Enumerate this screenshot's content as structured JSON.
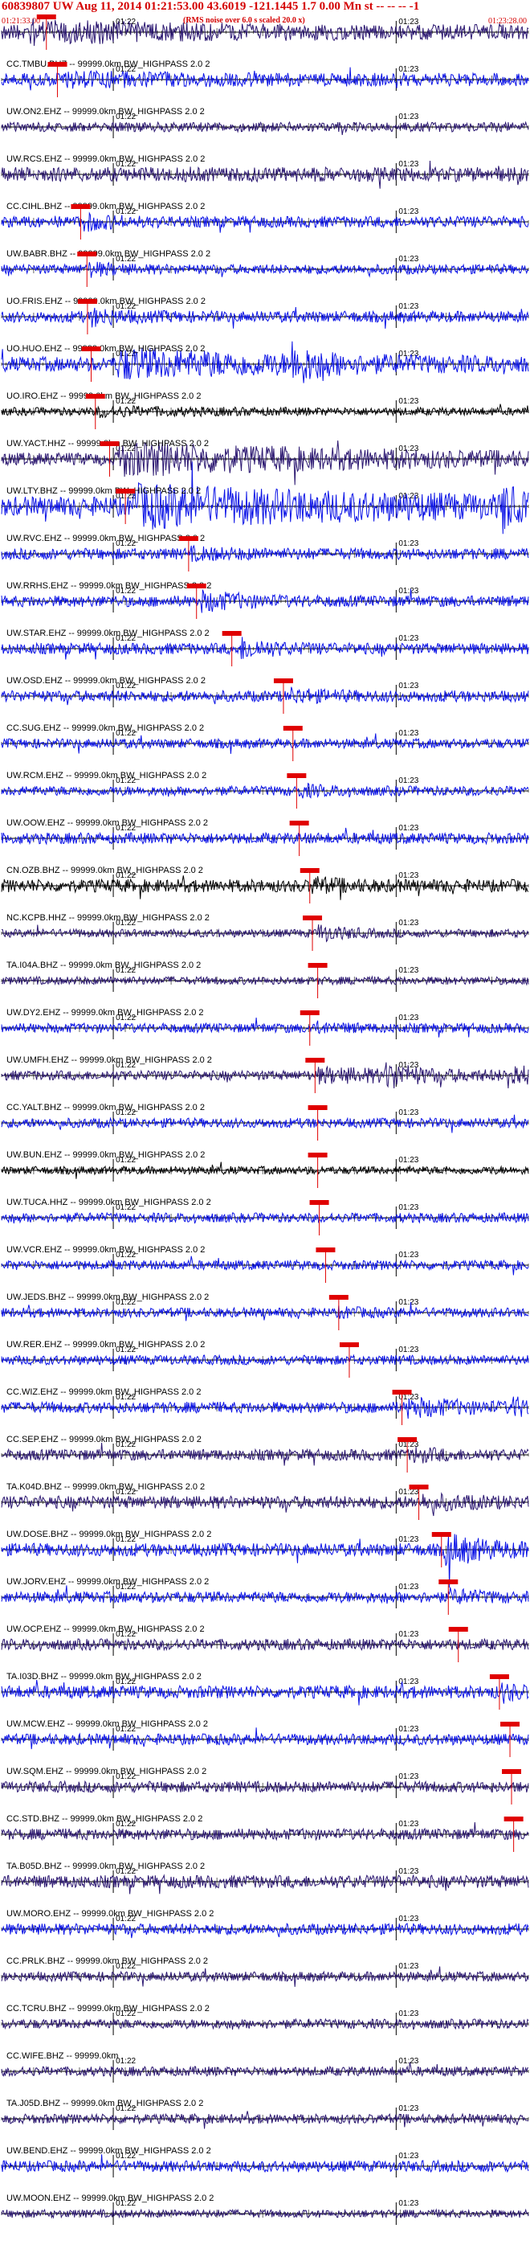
{
  "header": {
    "title": "60839807 UW Aug 11, 2014 01:21:53.00   43.6019 -121.1445  1.7 0.00 Mn st -- -- --  -1",
    "note": "(RMS noise over 6.0 s scaled 20.0 x)",
    "start_time": "01:21:33.00",
    "end_time": "01:23:28.00"
  },
  "colors": {
    "pick": "#e00000",
    "trace_blue": "#0a12e6",
    "trace_navy": "#2a1670",
    "trace_black": "#000000",
    "axis": "#000000"
  },
  "chart_data": {
    "type": "line",
    "x_ticks": [
      {
        "label": "01:22",
        "t": 0.212
      },
      {
        "label": "01:23",
        "t": 0.749
      }
    ],
    "traces": [
      {
        "label": "",
        "color": "navy",
        "amp": 9,
        "pick": 0.085,
        "bursts": [
          [
            0.05,
            0.3,
            2.0
          ]
        ]
      },
      {
        "label": "CC.TMBU.BHZ -- 99999.0km BW_HIGHPASS  2.0  2",
        "color": "blue",
        "amp": 8,
        "pick": 0.106,
        "bursts": [
          [
            0.12,
            0.25,
            1.5
          ]
        ]
      },
      {
        "label": "UW.ON2.EHZ -- 99999.0km BW_HIGHPASS  2.0  2",
        "color": "navy",
        "amp": 6,
        "pick": null,
        "bursts": []
      },
      {
        "label": "UW.RCS.EHZ -- 99999.0km BW_HIGHPASS  2.0  2",
        "color": "navy",
        "amp": 9,
        "pick": null,
        "bursts": []
      },
      {
        "label": "CC.CIHL.BHZ -- 99999.0km BW_HIGHPASS  2.0  2",
        "color": "blue",
        "amp": 7,
        "pick": 0.15,
        "bursts": [
          [
            0.155,
            0.05,
            2.0
          ]
        ]
      },
      {
        "label": "UW.BABR.BHZ -- 99999.0km BW_HIGHPASS  2.0  2",
        "color": "blue",
        "amp": 6,
        "pick": 0.162,
        "bursts": [
          [
            0.165,
            0.05,
            2.0
          ]
        ]
      },
      {
        "label": "UO.FRIS.EHZ -- 99999.0km BW_HIGHPASS  2.0  2",
        "color": "blue",
        "amp": 7,
        "pick": 0.163,
        "bursts": [
          [
            0.17,
            0.06,
            2.0
          ]
        ]
      },
      {
        "label": "UO.HUO.EHZ -- 99999.0km BW_HIGHPASS  2.0  2",
        "color": "blue",
        "amp": 9,
        "pick": 0.17,
        "bursts": [
          [
            0.22,
            0.35,
            2.5
          ],
          [
            0.55,
            0.04,
            3.2
          ]
        ]
      },
      {
        "label": "UO.IRO.EHZ -- 99999.0km BW_HIGHPASS  2.0  2",
        "color": "black",
        "amp": 5,
        "pick": 0.178,
        "bursts": [
          [
            0.18,
            0.15,
            1.8
          ]
        ]
      },
      {
        "label": "UW.YACT.HHZ -- 99999.0km BW_HIGHPASS  2.0  2",
        "color": "navy",
        "amp": 8,
        "pick": 0.205,
        "bursts": [
          [
            0.22,
            0.45,
            3.0
          ]
        ]
      },
      {
        "label": "UW.LTY.BHZ -- 99999.0km BW_HIGHPASS  2.0  2",
        "color": "blue",
        "amp": 12,
        "pick": 0.235,
        "bursts": [
          [
            0.25,
            0.5,
            2.5
          ],
          [
            0.95,
            0.02,
            3.0
          ]
        ]
      },
      {
        "label": "UW.RVC.EHZ -- 99999.0km BW_HIGHPASS  2.0  2",
        "color": "blue",
        "amp": 7,
        "pick": 0.355,
        "bursts": [
          [
            0.36,
            0.1,
            1.5
          ]
        ]
      },
      {
        "label": "UW.RRHS.EHZ -- 99999.0km BW_HIGHPASS  2.0  2",
        "color": "blue",
        "amp": 7,
        "pick": 0.37,
        "bursts": [
          [
            0.38,
            0.08,
            2.2
          ]
        ]
      },
      {
        "label": "UW.STAR.EHZ -- 99999.0km BW_HIGHPASS  2.0  2",
        "color": "blue",
        "amp": 7,
        "pick": 0.437,
        "bursts": [
          [
            0.455,
            0.05,
            2.5
          ]
        ]
      },
      {
        "label": "UW.OSD.EHZ -- 99999.0km BW_HIGHPASS  2.0  2",
        "color": "blue",
        "amp": 7,
        "pick": 0.535,
        "bursts": [
          [
            0.55,
            0.06,
            1.8
          ]
        ]
      },
      {
        "label": "CC.SUG.EHZ -- 99999.0km BW_HIGHPASS  2.0  2",
        "color": "blue",
        "amp": 6,
        "pick": 0.553,
        "bursts": []
      },
      {
        "label": "UW.RCM.EHZ -- 99999.0km BW_HIGHPASS  2.0  2",
        "color": "blue",
        "amp": 6,
        "pick": 0.56,
        "bursts": [
          [
            0.565,
            0.05,
            1.8
          ]
        ]
      },
      {
        "label": "UW.OOW.EHZ -- 99999.0km BW_HIGHPASS  2.0  2",
        "color": "blue",
        "amp": 7,
        "pick": 0.565,
        "bursts": []
      },
      {
        "label": "CN.OZB.BHZ -- 99999.0km BW_HIGHPASS  2.0  2",
        "color": "black",
        "amp": 8,
        "pick": 0.585,
        "bursts": [
          [
            0.59,
            0.05,
            1.8
          ]
        ]
      },
      {
        "label": "NC.KCPB.HHZ -- 99999.0km BW_HIGHPASS  2.0  2",
        "color": "navy",
        "amp": 5,
        "pick": 0.59,
        "bursts": [
          [
            0.6,
            0.05,
            2.8
          ]
        ]
      },
      {
        "label": "TA.I04A.BHZ -- 99999.0km BW_HIGHPASS  2.0  2",
        "color": "navy",
        "amp": 5,
        "pick": 0.6,
        "bursts": []
      },
      {
        "label": "UW.DY2.EHZ -- 99999.0km BW_HIGHPASS  2.0  2",
        "color": "blue",
        "amp": 6,
        "pick": 0.585,
        "bursts": [
          [
            0.6,
            0.05,
            1.6
          ]
        ]
      },
      {
        "label": "UW.UMFH.EHZ -- 99999.0km BW_HIGHPASS  2.0  2",
        "color": "navy",
        "amp": 6,
        "pick": 0.595,
        "bursts": [
          [
            0.6,
            0.25,
            2.0
          ],
          [
            0.73,
            0.04,
            3.0
          ],
          [
            0.96,
            0.04,
            3.2
          ]
        ]
      },
      {
        "label": "CC.YALT.BHZ -- 99999.0km BW_HIGHPASS  2.0  2",
        "color": "blue",
        "amp": 6,
        "pick": 0.6,
        "bursts": []
      },
      {
        "label": "UW.BUN.EHZ -- 99999.0km BW_HIGHPASS  2.0  2",
        "color": "black",
        "amp": 5,
        "pick": 0.6,
        "bursts": []
      },
      {
        "label": "UW.TUCA.HHZ -- 99999.0km BW_HIGHPASS  2.0  2",
        "color": "blue",
        "amp": 6,
        "pick": 0.603,
        "bursts": []
      },
      {
        "label": "UW.VCR.EHZ -- 99999.0km BW_HIGHPASS  2.0  2",
        "color": "blue",
        "amp": 6,
        "pick": 0.615,
        "bursts": []
      },
      {
        "label": "UW.JEDS.BHZ -- 99999.0km BW_HIGHPASS  2.0  2",
        "color": "blue",
        "amp": 6,
        "pick": 0.64,
        "bursts": [
          [
            0.64,
            0.05,
            1.5
          ]
        ]
      },
      {
        "label": "UW.RER.EHZ -- 99999.0km BW_HIGHPASS  2.0  2",
        "color": "blue",
        "amp": 6,
        "pick": 0.66,
        "bursts": []
      },
      {
        "label": "CC.WIZ.EHZ -- 99999.0km BW_HIGHPASS  2.0  2",
        "color": "blue",
        "amp": 7,
        "pick": 0.76,
        "bursts": [
          [
            0.77,
            0.1,
            2.2
          ],
          [
            0.97,
            0.02,
            2.5
          ]
        ]
      },
      {
        "label": "CC.SEP.EHZ -- 99999.0km BW_HIGHPASS  2.0  2",
        "color": "navy",
        "amp": 7,
        "pick": 0.77,
        "bursts": [
          [
            0.78,
            0.05,
            1.8
          ]
        ]
      },
      {
        "label": "TA.K04D.BHZ -- 99999.0km BW_HIGHPASS  2.0  2",
        "color": "navy",
        "amp": 8,
        "pick": 0.792,
        "bursts": [
          [
            0.8,
            0.1,
            1.6
          ]
        ]
      },
      {
        "label": "UW.DOSE.BHZ -- 99999.0km BW_HIGHPASS  2.0  2",
        "color": "blue",
        "amp": 8,
        "pick": 0.835,
        "bursts": [
          [
            0.84,
            0.08,
            3.0
          ]
        ]
      },
      {
        "label": "UW.JORV.EHZ -- 99999.0km BW_HIGHPASS  2.0  2",
        "color": "blue",
        "amp": 7,
        "pick": 0.848,
        "bursts": [
          [
            0.85,
            0.05,
            1.8
          ]
        ]
      },
      {
        "label": "UW.OCP.EHZ -- 99999.0km BW_HIGHPASS  2.0  2",
        "color": "navy",
        "amp": 7,
        "pick": 0.867,
        "bursts": []
      },
      {
        "label": "TA.I03D.BHZ -- 99999.0km BW_HIGHPASS  2.0  2",
        "color": "blue",
        "amp": 8,
        "pick": 0.945,
        "bursts": [
          [
            0.95,
            0.03,
            2.0
          ]
        ]
      },
      {
        "label": "UW.MCW.EHZ -- 99999.0km BW_HIGHPASS  2.0  2",
        "color": "blue",
        "amp": 7,
        "pick": 0.965,
        "bursts": []
      },
      {
        "label": "UW.SQM.EHZ -- 99999.0km BW_HIGHPASS  2.0  2",
        "color": "navy",
        "amp": 7,
        "pick": 0.968,
        "bursts": []
      },
      {
        "label": "CC.STD.BHZ -- 99999.0km BW_HIGHPASS  2.0  2",
        "color": "navy",
        "amp": 7,
        "pick": 0.972,
        "bursts": []
      },
      {
        "label": "TA.B05D.BHZ -- 99999.0km BW_HIGHPASS  2.0  2",
        "color": "navy",
        "amp": 8,
        "pick": null,
        "bursts": []
      },
      {
        "label": "UW.MORO.EHZ -- 99999.0km BW_HIGHPASS  2.0  2",
        "color": "blue",
        "amp": 7,
        "pick": null,
        "bursts": []
      },
      {
        "label": "CC.PRLK.BHZ -- 99999.0km BW_HIGHPASS  2.0  2",
        "color": "navy",
        "amp": 6,
        "pick": null,
        "bursts": []
      },
      {
        "label": "CC.TCRU.BHZ -- 99999.0km BW_HIGHPASS  2.0  2",
        "color": "navy",
        "amp": 6,
        "pick": null,
        "bursts": []
      },
      {
        "label": "CC.WIFE.BHZ -- 99999.0km",
        "color": "navy",
        "amp": 6,
        "pick": null,
        "bursts": []
      },
      {
        "label": "TA.J05D.BHZ -- 99999.0km BW_HIGHPASS  2.0  2",
        "color": "navy",
        "amp": 6,
        "pick": null,
        "bursts": []
      },
      {
        "label": "UW.BEND.EHZ -- 99999.0km BW_HIGHPASS  2.0  2",
        "color": "blue",
        "amp": 7,
        "pick": null,
        "bursts": []
      },
      {
        "label": "UW.MOON.EHZ -- 99999.0km BW_HIGHPASS  2.0  2",
        "color": "navy",
        "amp": 5,
        "pick": null,
        "bursts": []
      }
    ]
  }
}
